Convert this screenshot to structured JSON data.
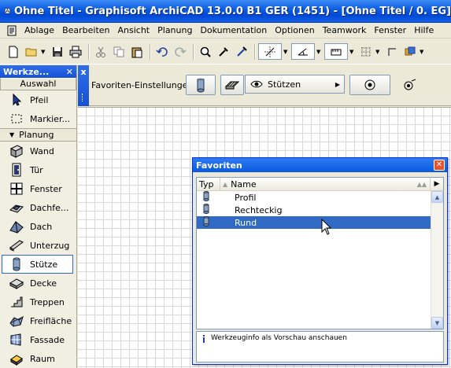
{
  "window": {
    "title": "Ohne Titel - Graphisoft ArchiCAD 13.0.0 B1 GER (1451) - [Ohne Titel / 0. EG]"
  },
  "menu": [
    "Ablage",
    "Bearbeiten",
    "Ansicht",
    "Planung",
    "Dokumentation",
    "Optionen",
    "Teamwork",
    "Fenster",
    "Hilfe"
  ],
  "toolbox": {
    "title": "Werkze...",
    "section": "Auswahl",
    "select_tools": [
      {
        "label": "Pfeil",
        "icon": "arrow-icon"
      },
      {
        "label": "Markier...",
        "icon": "marquee-icon"
      }
    ],
    "group": "Planung",
    "tools": [
      {
        "label": "Wand",
        "icon": "wall-icon"
      },
      {
        "label": "Tür",
        "icon": "door-icon"
      },
      {
        "label": "Fenster",
        "icon": "window-icon"
      },
      {
        "label": "Dachfe...",
        "icon": "roof-window-icon"
      },
      {
        "label": "Dach",
        "icon": "roof-icon"
      },
      {
        "label": "Unterzug",
        "icon": "beam-icon"
      },
      {
        "label": "Stütze",
        "icon": "column-icon",
        "active": true
      },
      {
        "label": "Decke",
        "icon": "slab-icon"
      },
      {
        "label": "Treppen",
        "icon": "stair-icon"
      },
      {
        "label": "Freifläche",
        "icon": "mesh-icon"
      },
      {
        "label": "Fassade",
        "icon": "curtain-wall-icon"
      },
      {
        "label": "Raum",
        "icon": "zone-icon"
      }
    ]
  },
  "infobox": {
    "close": "x",
    "favorites_label": "Favoriten-Einstellungen",
    "layer_select": "Stützen"
  },
  "favorites": {
    "title": "Favoriten",
    "col_type": "Typ",
    "col_name": "Name",
    "items": [
      {
        "name": "Profil",
        "selected": false
      },
      {
        "name": "Rechteckig",
        "selected": false
      },
      {
        "name": "Rund",
        "selected": true
      }
    ],
    "info": "Werkzeuginfo als Vorschau anschauen"
  }
}
